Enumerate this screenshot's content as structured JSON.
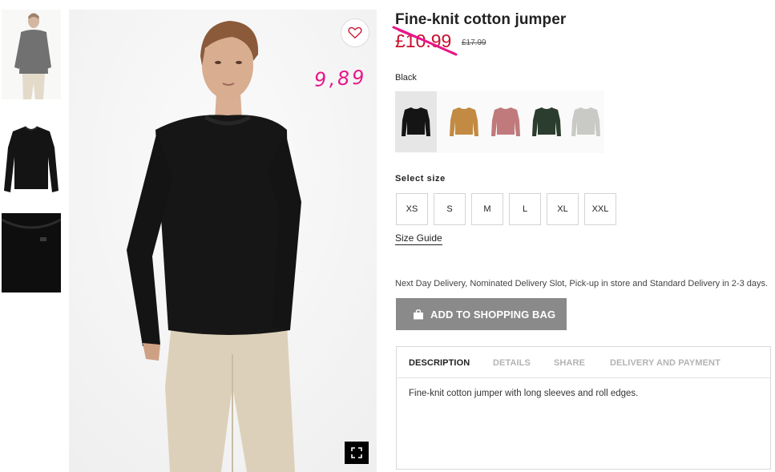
{
  "product": {
    "title": "Fine-knit cotton jumper",
    "sale_price": "£10.99",
    "old_price": "£17.99",
    "handwritten_price": "9,89",
    "selected_color": "Black"
  },
  "swatches": [
    {
      "name": "Black",
      "color": "#151515",
      "selected": true
    },
    {
      "name": "Mustard",
      "color": "#c28a42",
      "selected": false
    },
    {
      "name": "Dusty pink",
      "color": "#c07a7c",
      "selected": false
    },
    {
      "name": "Dark green",
      "color": "#2b3d2e",
      "selected": false
    },
    {
      "name": "Light grey",
      "color": "#c9c9c5",
      "selected": false
    }
  ],
  "sizes": {
    "label": "Select size",
    "options": [
      "XS",
      "S",
      "M",
      "L",
      "XL",
      "XXL"
    ],
    "guide_label": "Size Guide"
  },
  "delivery_text": "Next Day Delivery, Nominated Delivery Slot, Pick-up in store and Standard Delivery in 2-3 days.",
  "add_to_bag": {
    "label": "ADD TO SHOPPING BAG",
    "icon": "shopping-bag-icon"
  },
  "tabs": {
    "items": [
      "DESCRIPTION",
      "DETAILS",
      "SHARE",
      "DELIVERY AND PAYMENT"
    ],
    "active": "DESCRIPTION",
    "content": "Fine-knit cotton jumper with long sleeves and roll edges."
  },
  "icons": {
    "favourite": "heart-icon",
    "expand": "expand-icon"
  },
  "colors": {
    "sale_price": "#c8102e",
    "annotation": "#e8168a",
    "button": "#8a8a8a"
  }
}
